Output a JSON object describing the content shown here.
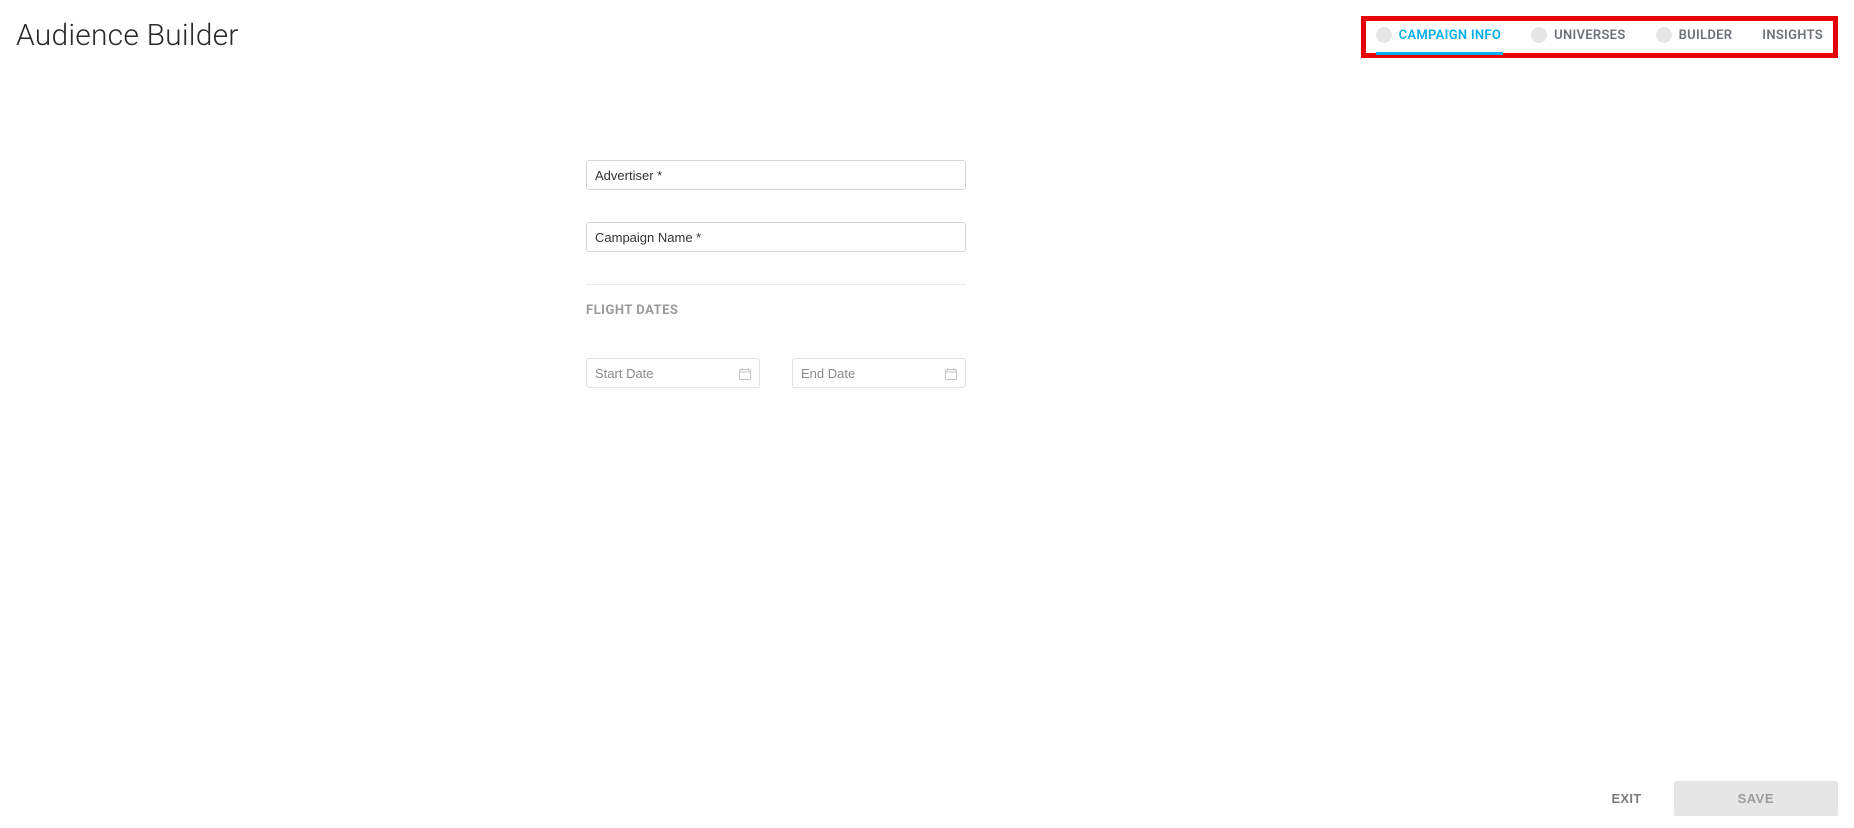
{
  "page": {
    "title": "Audience Builder"
  },
  "tabs": {
    "items": [
      {
        "label": "CAMPAIGN INFO",
        "active": true,
        "hasCircle": true
      },
      {
        "label": "UNIVERSES",
        "active": false,
        "hasCircle": true
      },
      {
        "label": "BUILDER",
        "active": false,
        "hasCircle": true
      },
      {
        "label": "INSIGHTS",
        "active": false,
        "hasCircle": false
      }
    ]
  },
  "form": {
    "advertiser": {
      "placeholder": "Advertiser *",
      "value": ""
    },
    "campaignName": {
      "placeholder": "Campaign Name *",
      "value": ""
    },
    "flightDatesLabel": "FLIGHT DATES",
    "startDate": {
      "placeholder": "Start Date",
      "value": ""
    },
    "endDate": {
      "placeholder": "End Date",
      "value": ""
    }
  },
  "footer": {
    "exitLabel": "EXIT",
    "saveLabel": "SAVE"
  },
  "annotation": {
    "highlightColor": "#e60000"
  }
}
